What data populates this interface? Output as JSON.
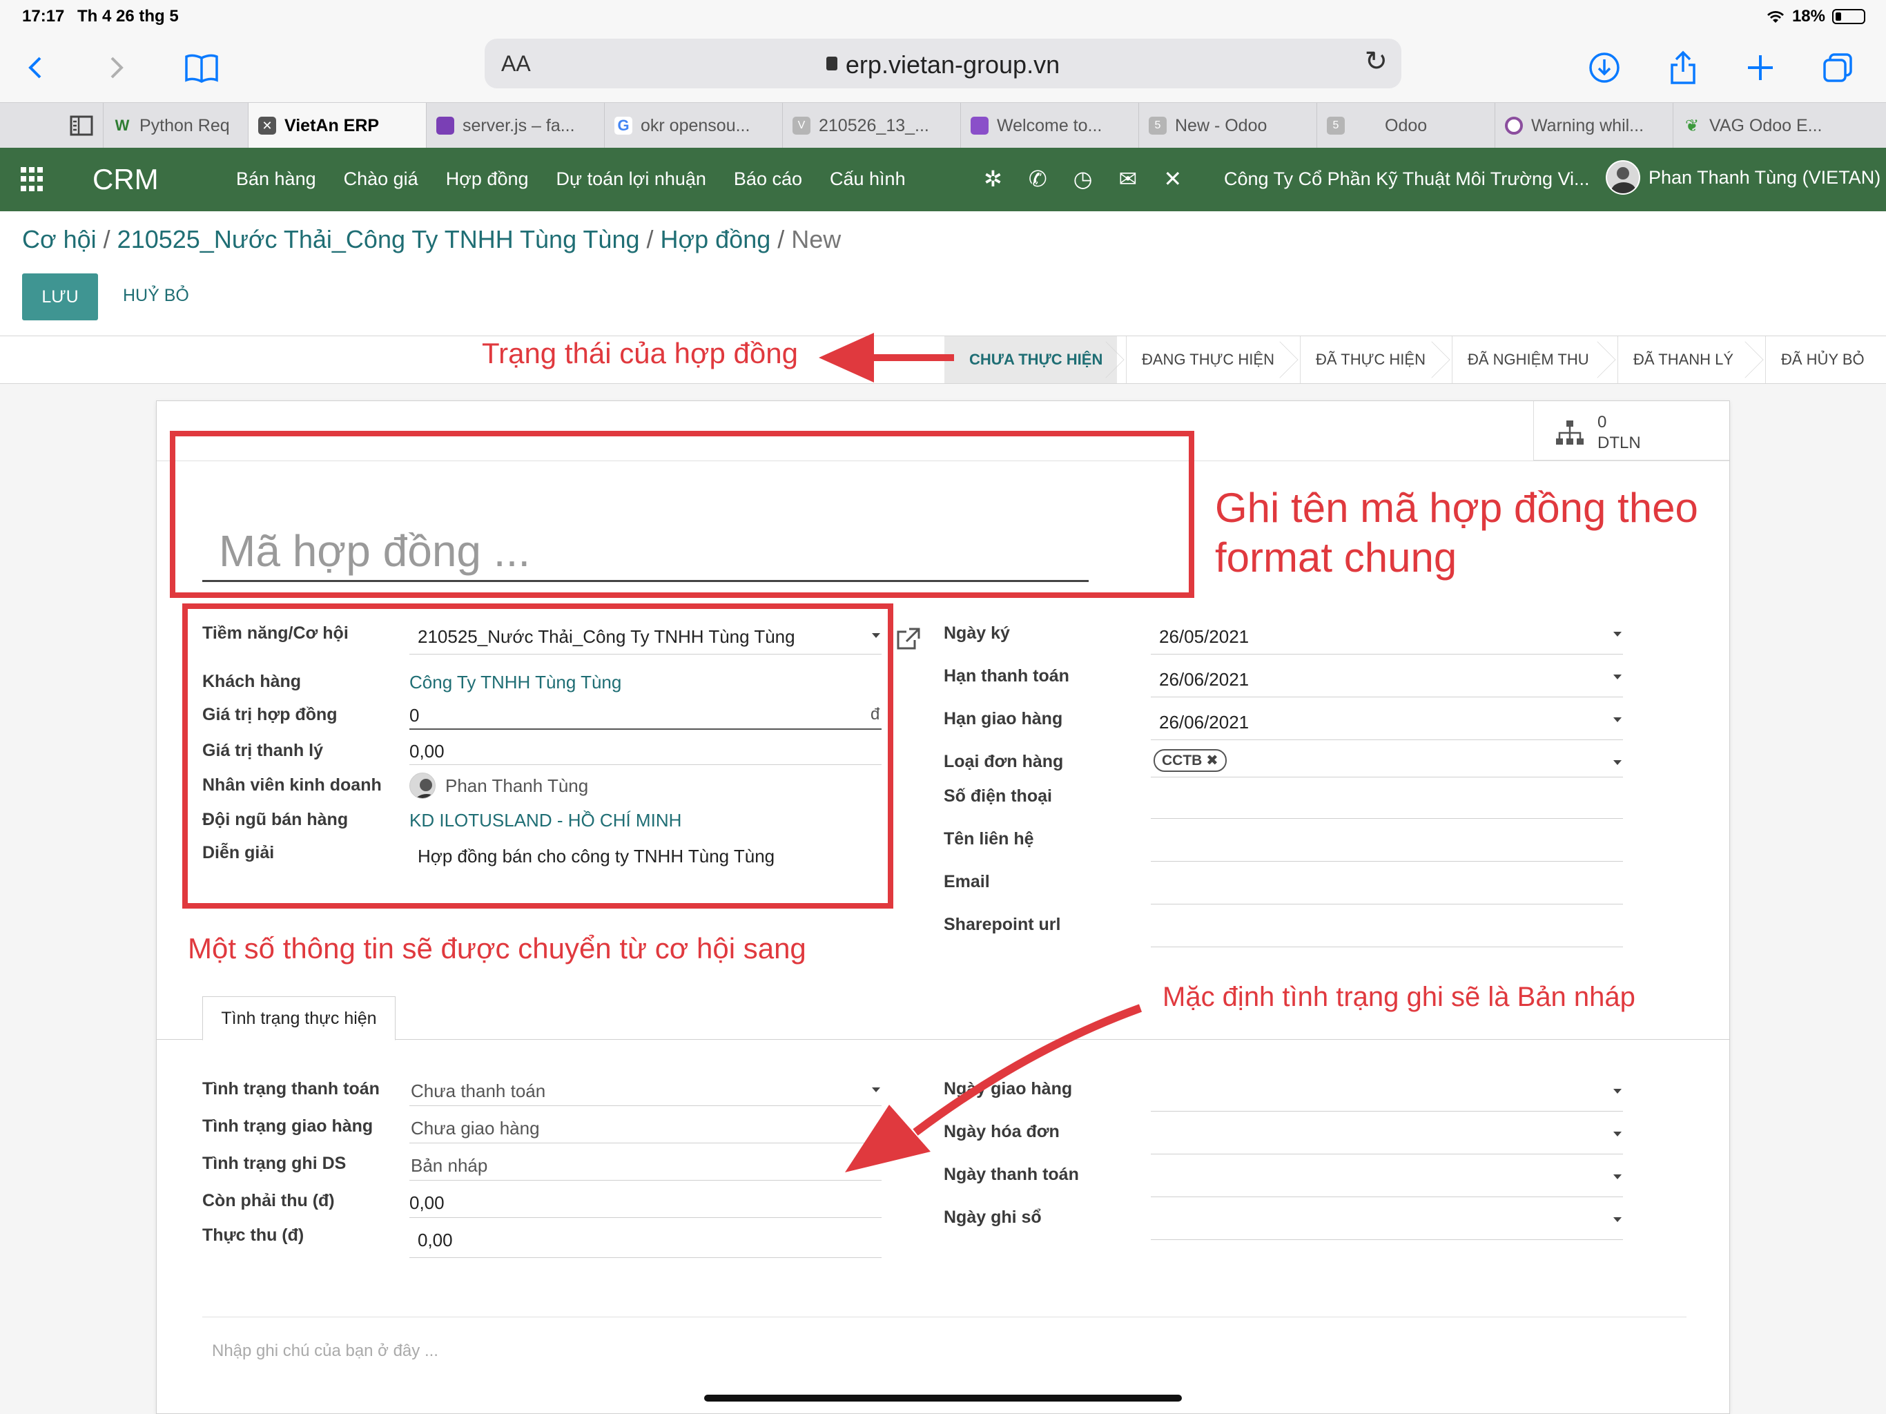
{
  "status_bar": {
    "time": "17:17",
    "date": "Th 4 26 thg 5",
    "battery": "18%"
  },
  "browser": {
    "url_aa": "AA",
    "url": "erp.vietan-group.vn",
    "tabs": [
      {
        "label": "Python Req",
        "active": false
      },
      {
        "label": "VietAn ERP",
        "active": true
      },
      {
        "label": "server.js – fa...",
        "active": false
      },
      {
        "label": "okr opensou...",
        "active": false
      },
      {
        "label": "210526_13_...",
        "active": false
      },
      {
        "label": "Welcome to...",
        "active": false
      },
      {
        "label": "New - Odoo",
        "active": false
      },
      {
        "label": "Odoo",
        "active": false
      },
      {
        "label": "Warning whil...",
        "active": false
      },
      {
        "label": "VAG Odoo E...",
        "active": false
      }
    ]
  },
  "navbar": {
    "brand": "CRM",
    "menu": [
      "Bán hàng",
      "Chào giá",
      "Hợp đồng",
      "Dự toán lợi nhuận",
      "Báo cáo",
      "Cấu hình"
    ],
    "company": "Công Ty Cổ Phần Kỹ Thuật Môi Trường Vi...",
    "user": "Phan Thanh Tùng (VIETAN)"
  },
  "breadcrumb": {
    "items": [
      "Cơ hội",
      "210525_Nước Thải_Công Ty TNHH Tùng Tùng",
      "Hợp đồng"
    ],
    "current": "New"
  },
  "actions": {
    "save": "LƯU",
    "discard": "HUỶ BỎ"
  },
  "stages": [
    "CHƯA THỰC HIỆN",
    "ĐANG THỰC HIỆN",
    "ĐÃ THỰC HIỆN",
    "ĐÃ NGHIỆM THU",
    "ĐÃ THANH LÝ",
    "ĐÃ HỦY BỎ"
  ],
  "active_stage": "CHƯA THỰC HIỆN",
  "smart_button": {
    "count": "0",
    "label": "DTLN"
  },
  "form": {
    "name_placeholder": "Mã hợp đồng ...",
    "left": {
      "opportunity_label": "Tiềm năng/Cơ hội",
      "opportunity_value": "210525_Nước Thải_Công Ty TNHH Tùng Tùng",
      "customer_label": "Khách hàng",
      "customer_value": "Công Ty TNHH Tùng Tùng",
      "contract_value_label": "Giá trị hợp đồng",
      "contract_value": "0",
      "currency_symbol": "đ",
      "liquidation_label": "Giá trị thanh lý",
      "liquidation_value": "0,00",
      "salesperson_label": "Nhân viên kinh doanh",
      "salesperson_value": "Phan Thanh Tùng",
      "team_label": "Đội ngũ bán hàng",
      "team_value": "KD ILOTUSLAND - HỒ CHÍ MINH",
      "description_label": "Diễn giải",
      "description_value": "Hợp đồng bán cho công ty TNHH Tùng Tùng"
    },
    "right": {
      "sign_date_label": "Ngày ký",
      "sign_date": "26/05/2021",
      "payment_due_label": "Hạn thanh toán",
      "payment_due": "26/06/2021",
      "delivery_due_label": "Hạn giao hàng",
      "delivery_due": "26/06/2021",
      "order_type_label": "Loại đơn hàng",
      "order_type_tag": "CCTB",
      "phone_label": "Số điện thoại",
      "contact_label": "Tên liên hệ",
      "email_label": "Email",
      "sharepoint_label": "Sharepoint url"
    },
    "notebook_tab": "Tình trạng thực hiện",
    "status_left": {
      "payment_status_label": "Tình trạng thanh toán",
      "payment_status": "Chưa thanh toán",
      "delivery_status_label": "Tình trạng giao hàng",
      "delivery_status": "Chưa giao hàng",
      "ds_status_label": "Tình trạng ghi DS",
      "ds_status": "Bản nháp",
      "receivable_label": "Còn phải thu (đ)",
      "receivable": "0,00",
      "collected_label": "Thực thu (đ)",
      "collected": "0,00"
    },
    "status_right": {
      "delivery_date_label": "Ngày giao hàng",
      "invoice_date_label": "Ngày hóa đơn",
      "payment_date_label": "Ngày thanh toán",
      "posting_date_label": "Ngày ghi sổ"
    },
    "note_placeholder": "Nhập ghi chú của bạn ở đây ..."
  },
  "annotations": {
    "status_note": "Trạng thái của hợp đồng",
    "name_note_line1": "Ghi tên mã hợp đồng theo",
    "name_note_line2": "format chung",
    "transfer_note": "Một số thông tin sẽ được chuyển từ cơ hội sang",
    "default_note": "Mặc định tình trạng ghi sẽ là Bản nháp"
  },
  "colors": {
    "navbar": "#3b6e43",
    "primary": "#3f9592",
    "link": "#1f6e74",
    "annotation": "#e0393e"
  }
}
